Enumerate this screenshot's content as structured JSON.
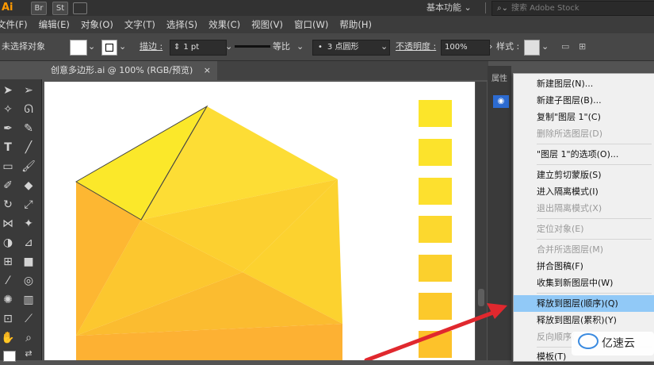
{
  "app": {
    "logo": "Ai",
    "bridge_label": "Br",
    "stock_label": "St",
    "workspace": "基本功能",
    "stock_search_placeholder": "搜索 Adobe Stock"
  },
  "menubar": {
    "items": [
      "文件(F)",
      "编辑(E)",
      "对象(O)",
      "文字(T)",
      "选择(S)",
      "效果(C)",
      "视图(V)",
      "窗口(W)",
      "帮助(H)"
    ]
  },
  "controlbar": {
    "selection_status": "未选择对象",
    "stroke_label": "描边 :",
    "stroke_weight": "1 pt",
    "stroke_profile": "等比",
    "brush": "3 点圆形",
    "opacity_label": "不透明度 :",
    "opacity_value": "100%",
    "style_label": "样式 :"
  },
  "document": {
    "tab_title": "创意多边形.ai @ 100% (RGB/预览)",
    "close_glyph": "×"
  },
  "panel": {
    "header": "属性"
  },
  "context_menu": {
    "items": [
      {
        "label": "新建图层(N)...",
        "enabled": true
      },
      {
        "label": "新建子图层(B)...",
        "enabled": true
      },
      {
        "label": "复制\"图层 1\"(C)",
        "enabled": true
      },
      {
        "label": "删除所选图层(D)",
        "enabled": false
      },
      {
        "label": "\"图层 1\"的选项(O)...",
        "enabled": true
      },
      {
        "label": "建立剪切蒙版(S)",
        "enabled": true
      },
      {
        "label": "进入隔离模式(I)",
        "enabled": true
      },
      {
        "label": "退出隔离模式(X)",
        "enabled": false
      },
      {
        "label": "定位对象(E)",
        "enabled": false
      },
      {
        "label": "合并所选图层(M)",
        "enabled": false
      },
      {
        "label": "拼合图稿(F)",
        "enabled": true
      },
      {
        "label": "收集到新图层中(W)",
        "enabled": true
      },
      {
        "label": "释放到图层(顺序)(Q)",
        "enabled": true,
        "highlighted": true
      },
      {
        "label": "释放到图层(累积)(Y)",
        "enabled": true
      },
      {
        "label": "反向顺序(",
        "enabled": false
      },
      {
        "label": "模板(T)",
        "enabled": true
      }
    ]
  },
  "watermark": {
    "text": "亿速云"
  },
  "colors": {
    "highlight": "#91c9f7",
    "arrow": "#e0282e",
    "swatch_yellows": [
      "#fce52a",
      "#fce32c",
      "#fde02e",
      "#fcd82e",
      "#fbd02d",
      "#fcc92b",
      "#fdc22a"
    ]
  }
}
